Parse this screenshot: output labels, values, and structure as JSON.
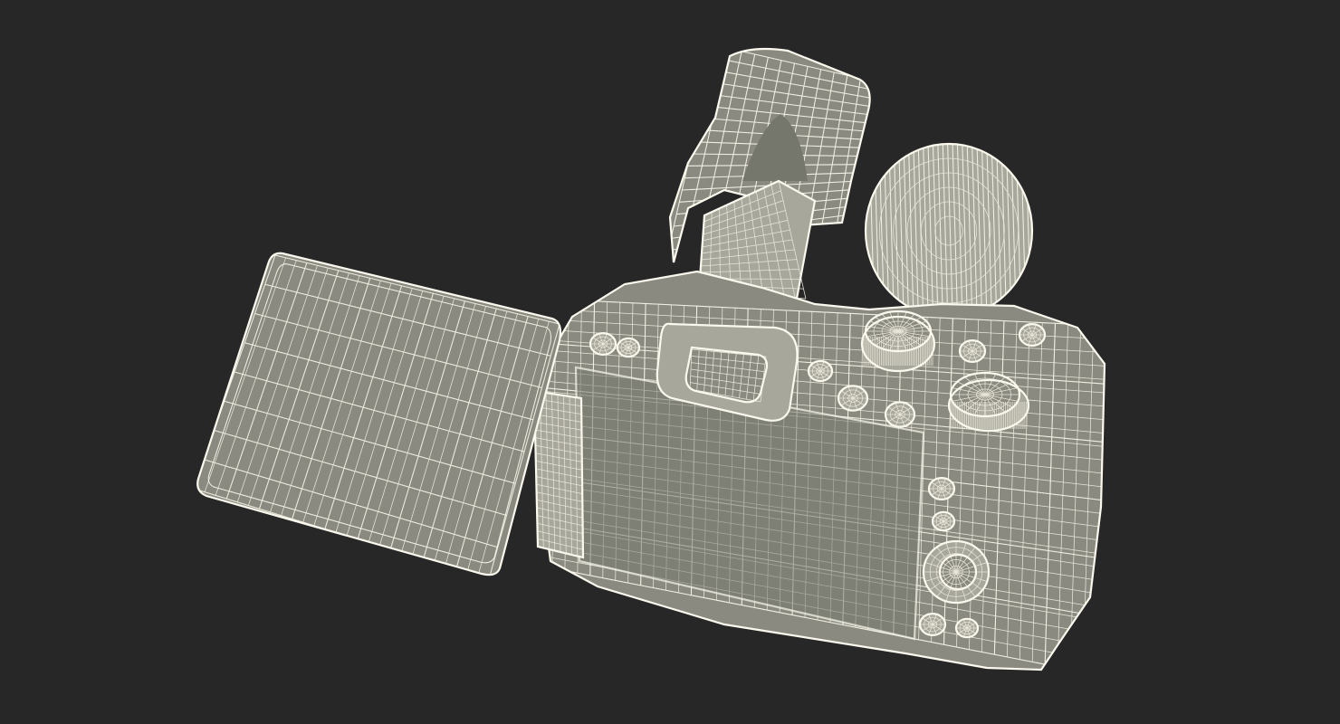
{
  "scene": {
    "subject": "dslr-camera-wireframe",
    "background_color": "#272727",
    "surface_color": "#8a8a80",
    "wire_color": "#f1efe2"
  }
}
